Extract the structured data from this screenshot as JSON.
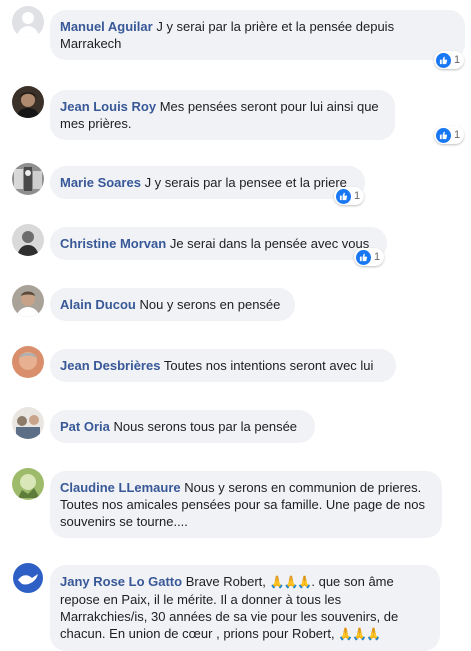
{
  "comments": [
    {
      "author": "Manuel Aguilar",
      "text": "J y serai par la prière et la pensée depuis Marrakech",
      "reaction_count": "1"
    },
    {
      "author": "Jean Louis Roy",
      "text": "Mes pensées seront pour lui ainsi que mes prières.",
      "reaction_count": "1"
    },
    {
      "author": "Marie Soares",
      "text": "J y serais par la pensee et la priere",
      "reaction_count": "1"
    },
    {
      "author": "Christine Morvan",
      "text": "Je serai dans la pensée avec vous",
      "reaction_count": "1"
    },
    {
      "author": "Alain Ducou",
      "text": "Nou y serons en pensée"
    },
    {
      "author": "Jean Desbrières",
      "text": "Toutes nos intentions seront avec lui"
    },
    {
      "author": "Pat Oria",
      "text": "Nous serons tous par la pensée"
    },
    {
      "author": "Claudine LLemaure",
      "text": "Nous y serons en communion de prieres. Toutes nos amicales pensées pour sa famille. Une page de nos souvenirs se tourne...."
    },
    {
      "author": "Jany Rose Lo Gatto",
      "text_a": "Brave Robert,",
      "text_b": ". que son âme repose en Paix, il le mérite. Il a donner à tous les Marrakchies/is, 30 années de sa vie pour les souvenirs, de chacun. En union de cœur , prions pour Robert,",
      "emoji": "🙏🙏🙏"
    }
  ],
  "colors": {
    "author": "#385898",
    "bubble": "#f0f2f5",
    "like": "#1877f2"
  },
  "icons": {
    "like": "thumbs-up-icon",
    "emoji": "folded-hands-icon"
  }
}
